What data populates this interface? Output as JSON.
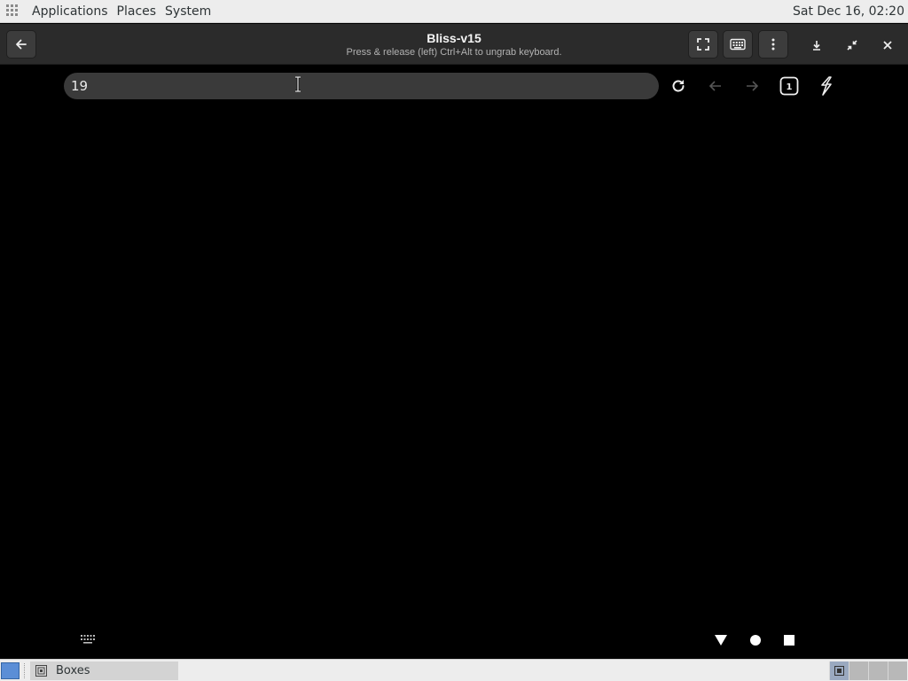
{
  "top_panel": {
    "menus": [
      "Applications",
      "Places",
      "System"
    ],
    "clock": "Sat Dec 16, 02:20"
  },
  "window": {
    "title": "Bliss-v15",
    "subtitle": "Press & release (left) Ctrl+Alt to ungrab keyboard."
  },
  "browser": {
    "url_value": "19",
    "tabs_count": "1"
  },
  "taskbar": {
    "tasks": [
      "Boxes"
    ]
  },
  "colors": {
    "guest_background": "#000000",
    "header_bar": "#2b2b2b",
    "url_bar": "#3a3a3a",
    "panel": "#ededed"
  }
}
